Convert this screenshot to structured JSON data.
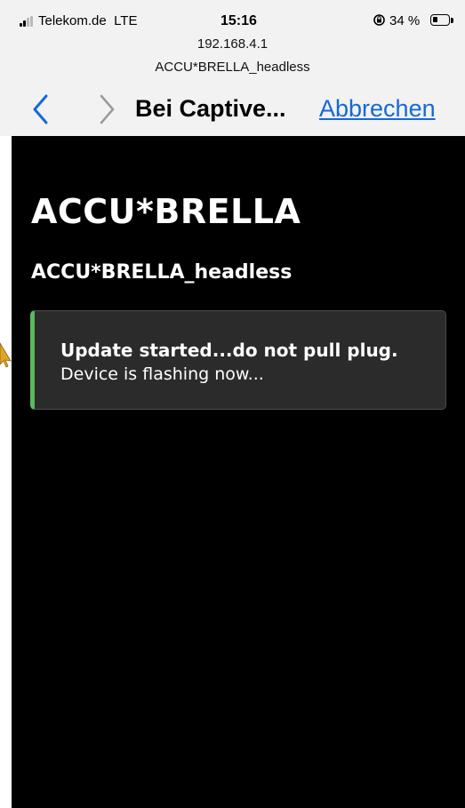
{
  "status_bar": {
    "carrier": "Telekom.de",
    "network": "LTE",
    "time": "15:16",
    "battery_percent": "34 %",
    "battery_level": 0.34,
    "rotation_lock_icon": "rotation-lock-icon"
  },
  "header": {
    "url": "192.168.4.1",
    "site_name": "ACCU*BRELLA_headless",
    "title": "Bei Captive...",
    "cancel_label": "Abbrechen",
    "back_icon": "chevron-left-icon",
    "forward_icon": "chevron-right-icon",
    "accent_color": "#1469d8"
  },
  "page": {
    "title": "ACCU*BRELLA",
    "subtitle": "ACCU*BRELLA_headless",
    "alert": {
      "title": "Update started...do not pull plug.",
      "message": "Device is flashing now...",
      "accent_color": "#5cb85c"
    }
  }
}
